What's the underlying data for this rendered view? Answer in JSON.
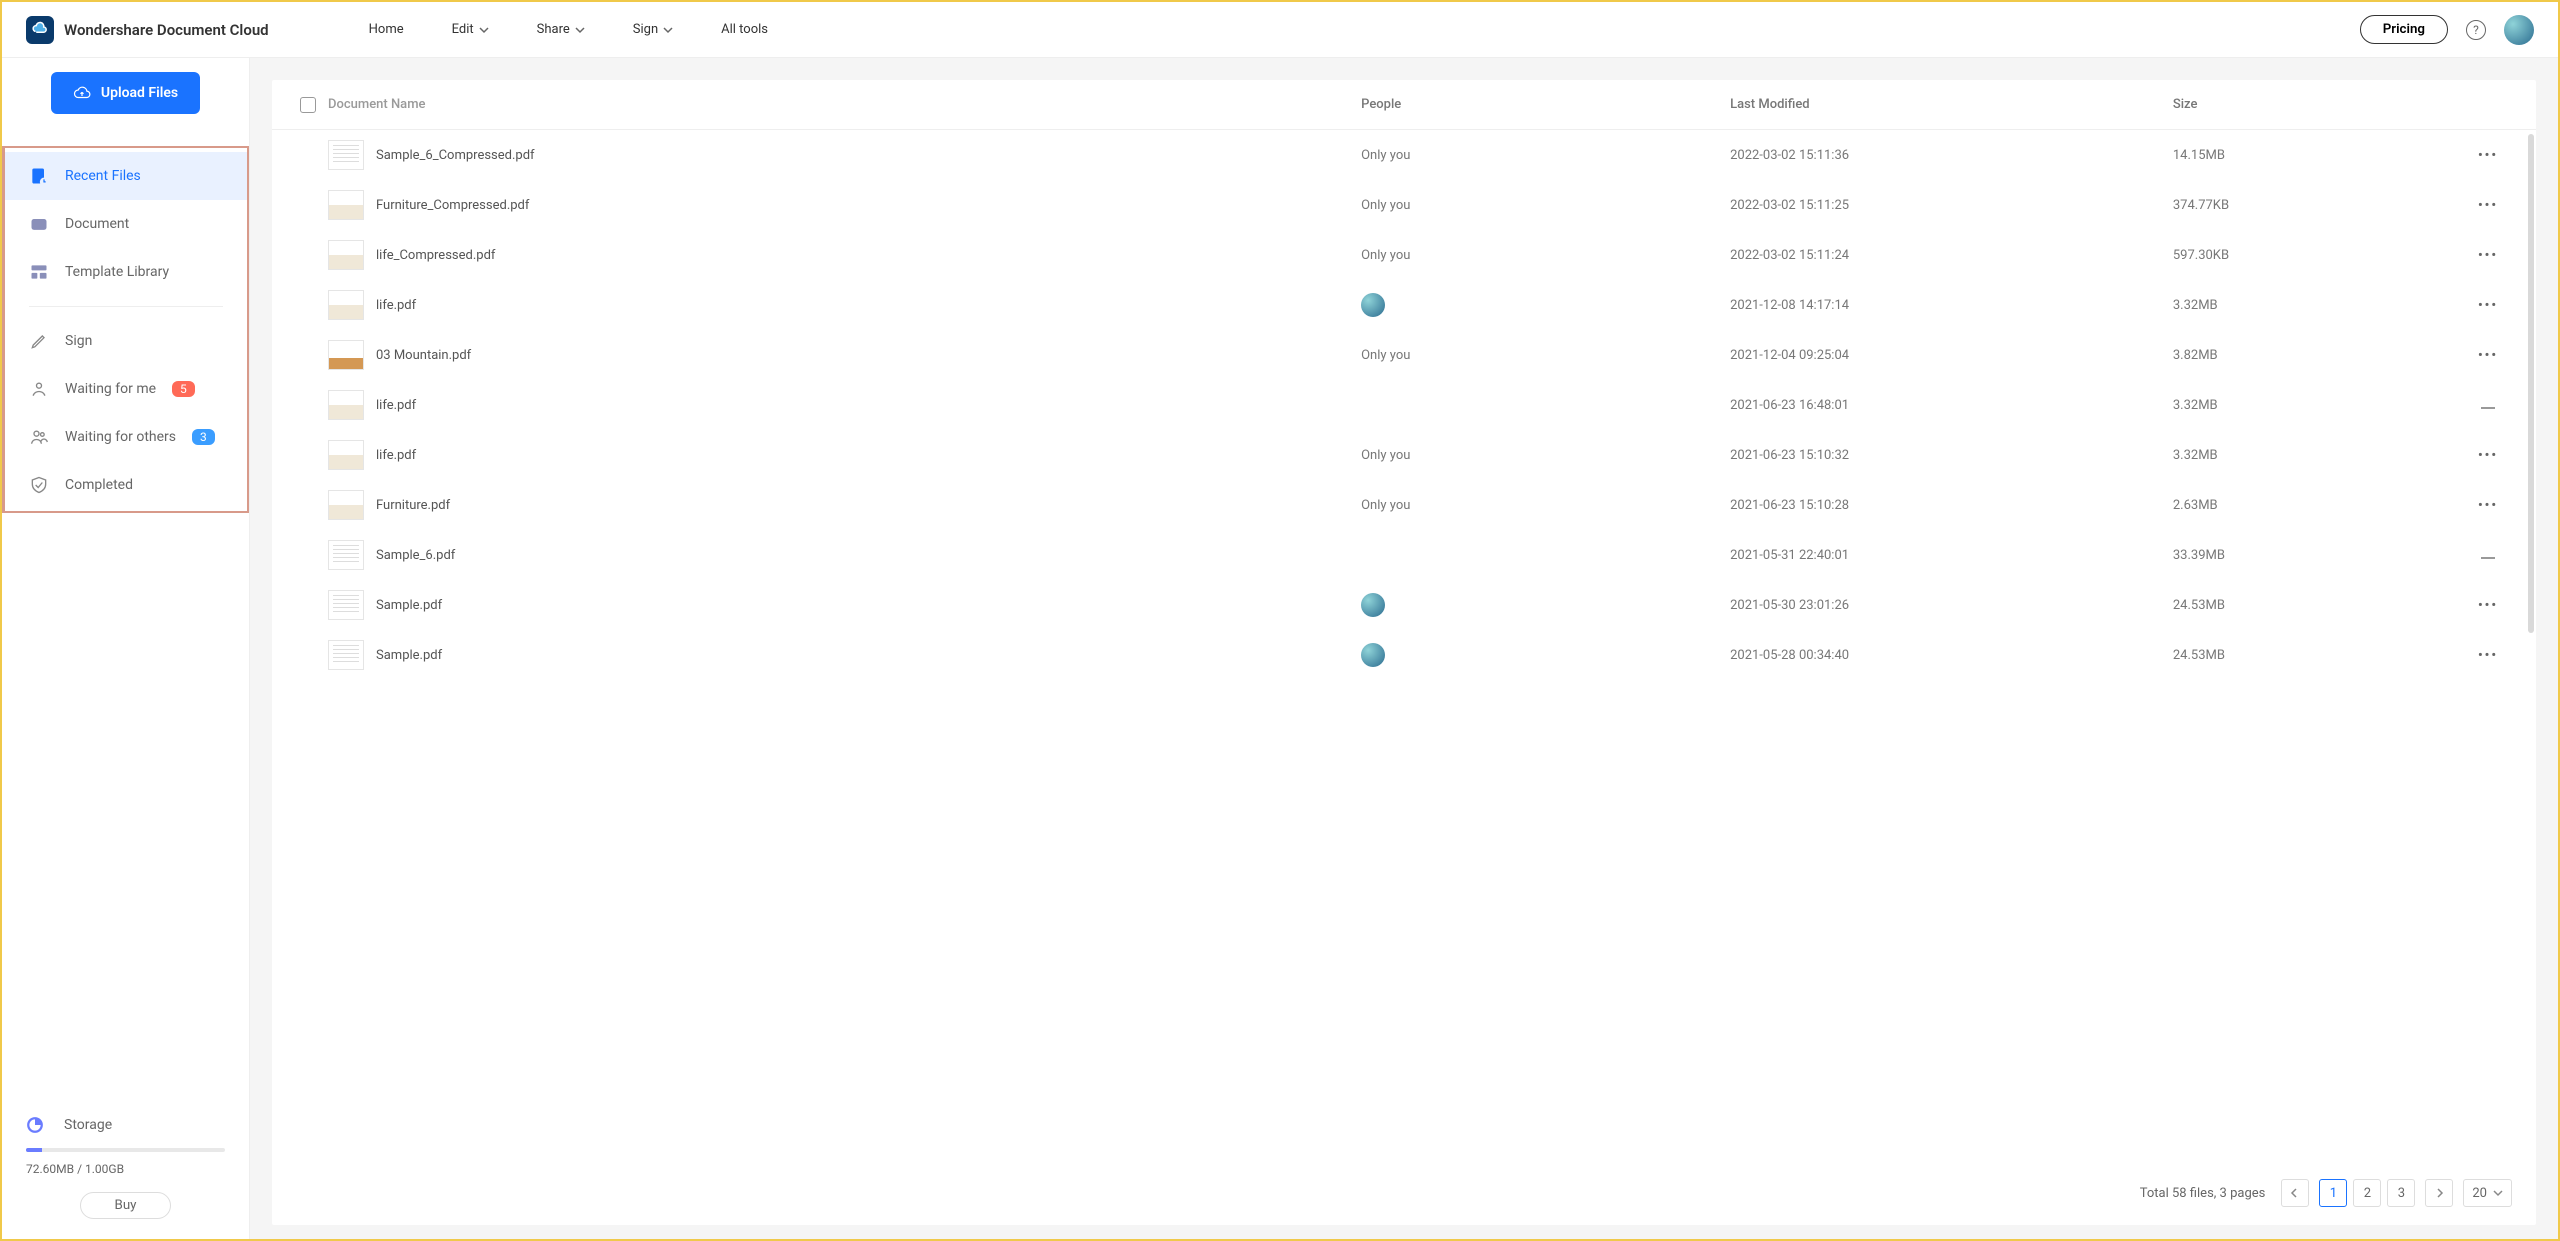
{
  "brand": "Wondershare Document Cloud",
  "nav": {
    "home": "Home",
    "edit": "Edit",
    "share": "Share",
    "sign": "Sign",
    "all": "All tools"
  },
  "pricing": "Pricing",
  "upload": "Upload Files",
  "side": {
    "recent": "Recent Files",
    "document": "Document",
    "template": "Template Library",
    "sign": "Sign",
    "wait_me": "Waiting for me",
    "wait_me_badge": "5",
    "wait_others": "Waiting for others",
    "wait_others_badge": "3",
    "completed": "Completed"
  },
  "storage": {
    "label": "Storage",
    "text": "72.60MB / 1.00GB",
    "buy": "Buy"
  },
  "columns": {
    "name": "Document Name",
    "people": "People",
    "modified": "Last Modified",
    "size": "Size"
  },
  "rows": [
    {
      "name": "Sample_6_Compressed.pdf",
      "people": "Only you",
      "modified": "2022-03-02 15:11:36",
      "size": "14.15MB",
      "thumb": "doc",
      "act": "dots"
    },
    {
      "name": "Furniture_Compressed.pdf",
      "people": "Only you",
      "modified": "2022-03-02 15:11:25",
      "size": "374.77KB",
      "thumb": "img",
      "act": "dots"
    },
    {
      "name": "life_Compressed.pdf",
      "people": "Only you",
      "modified": "2022-03-02 15:11:24",
      "size": "597.30KB",
      "thumb": "img",
      "act": "dots"
    },
    {
      "name": "life.pdf",
      "people": "avatar",
      "modified": "2021-12-08 14:17:14",
      "size": "3.32MB",
      "thumb": "img",
      "act": "dots"
    },
    {
      "name": "03 Mountain.pdf",
      "people": "Only you",
      "modified": "2021-12-04 09:25:04",
      "size": "3.82MB",
      "thumb": "mountain",
      "act": "dots"
    },
    {
      "name": "life.pdf",
      "people": "",
      "modified": "2021-06-23 16:48:01",
      "size": "3.32MB",
      "thumb": "img",
      "act": "dash"
    },
    {
      "name": "life.pdf",
      "people": "Only you",
      "modified": "2021-06-23 15:10:32",
      "size": "3.32MB",
      "thumb": "img",
      "act": "dots"
    },
    {
      "name": "Furniture.pdf",
      "people": "Only you",
      "modified": "2021-06-23 15:10:28",
      "size": "2.63MB",
      "thumb": "img",
      "act": "dots"
    },
    {
      "name": "Sample_6.pdf",
      "people": "",
      "modified": "2021-05-31 22:40:01",
      "size": "33.39MB",
      "thumb": "doc",
      "act": "dash"
    },
    {
      "name": "Sample.pdf",
      "people": "avatar",
      "modified": "2021-05-30 23:01:26",
      "size": "24.53MB",
      "thumb": "doc",
      "act": "dots"
    },
    {
      "name": "Sample.pdf",
      "people": "avatar",
      "modified": "2021-05-28 00:34:40",
      "size": "24.53MB",
      "thumb": "doc",
      "act": "dots"
    }
  ],
  "pager": {
    "info": "Total 58 files, 3 pages",
    "pages": [
      "1",
      "2",
      "3"
    ],
    "per_page": "20"
  }
}
